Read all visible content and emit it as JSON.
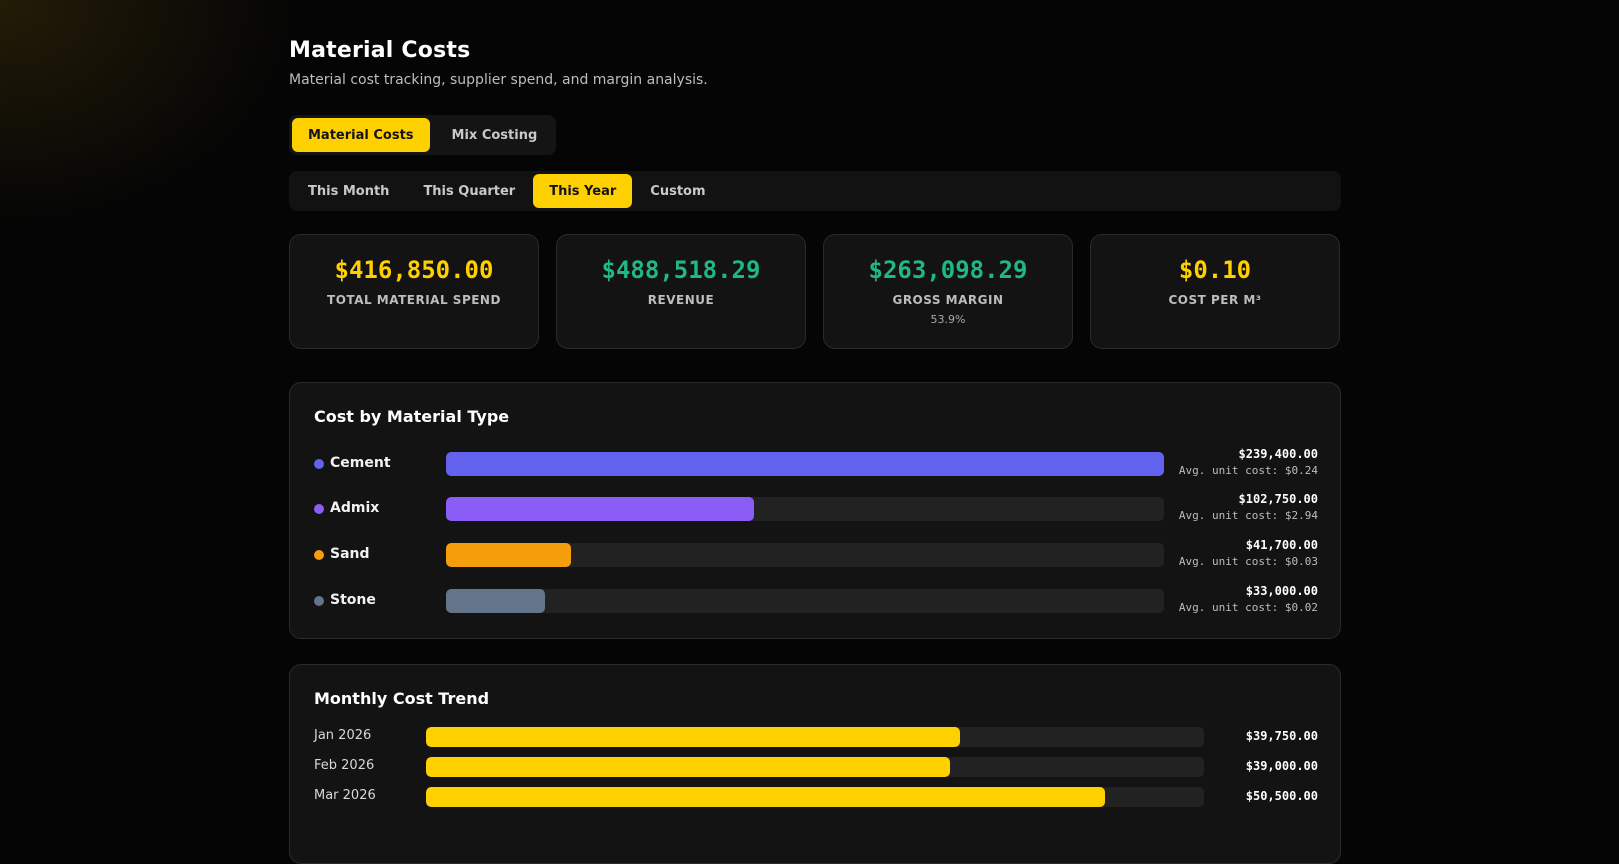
{
  "page": {
    "title": "Material Costs",
    "subtitle": "Material cost tracking, supplier spend, and margin analysis."
  },
  "main_tabs": [
    {
      "label": "Material Costs",
      "active": true
    },
    {
      "label": "Mix Costing",
      "active": false
    }
  ],
  "range_tabs": [
    {
      "label": "This Month",
      "active": false
    },
    {
      "label": "This Quarter",
      "active": false
    },
    {
      "label": "This Year",
      "active": true
    },
    {
      "label": "Custom",
      "active": false
    }
  ],
  "kpis": [
    {
      "value": "$416,850.00",
      "label": "Total Material Spend",
      "color": "#ffd000",
      "sub": ""
    },
    {
      "value": "$488,518.29",
      "label": "Revenue",
      "color": "#1fb884",
      "sub": ""
    },
    {
      "value": "$263,098.29",
      "label": "Gross Margin",
      "color": "#1fb884",
      "sub": "53.9%"
    },
    {
      "value": "$0.10",
      "label": "Cost per m³",
      "color": "#ffd000",
      "sub": ""
    }
  ],
  "cost_by_material": {
    "title": "Cost by Material Type",
    "items": [
      {
        "name": "Cement",
        "amount": "$239,400.00",
        "avg": "Avg. unit cost: $0.24",
        "value": 239400,
        "color": "#6262ee"
      },
      {
        "name": "Admix",
        "amount": "$102,750.00",
        "avg": "Avg. unit cost: $2.94",
        "value": 102750,
        "color": "#8b5cf6"
      },
      {
        "name": "Sand",
        "amount": "$41,700.00",
        "avg": "Avg. unit cost: $0.03",
        "value": 41700,
        "color": "#f59e0b"
      },
      {
        "name": "Stone",
        "amount": "$33,000.00",
        "avg": "Avg. unit cost: $0.02",
        "value": 33000,
        "color": "#64748b"
      }
    ]
  },
  "monthly_trend": {
    "title": "Monthly Cost Trend",
    "items": [
      {
        "month": "Jan 2026",
        "amount": "$39,750.00",
        "value": 39750
      },
      {
        "month": "Feb 2026",
        "amount": "$39,000.00",
        "value": 39000
      },
      {
        "month": "Mar 2026",
        "amount": "$50,500.00",
        "value": 50500
      }
    ],
    "scale_max": 57900
  }
}
